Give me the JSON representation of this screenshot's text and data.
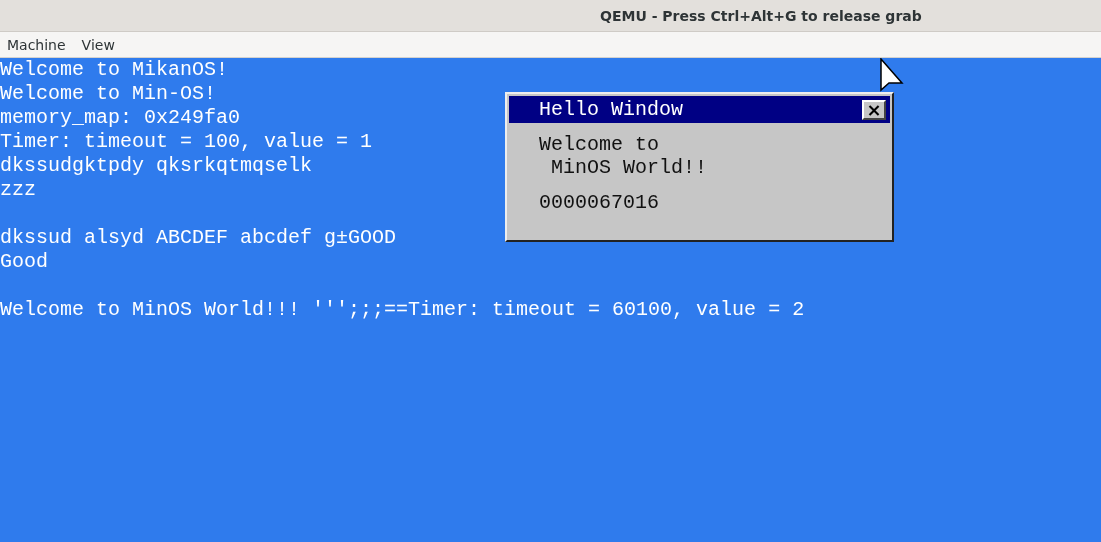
{
  "window": {
    "title": "QEMU - Press Ctrl+Alt+G to release grab"
  },
  "menu": [
    "Machine",
    "View"
  ],
  "console": {
    "paragraphs": [
      [
        "Welcome to MikanOS!",
        "Welcome to Min-OS!",
        "memory_map: 0x249fa0",
        "Timer: timeout = 100, value = 1",
        "dkssudgktpdy qksrkqtmqselk",
        "zzz"
      ],
      [
        "dkssud alsyd ABCDEF abcdef g±GOOD",
        "Good"
      ],
      [
        "Welcome to MinOS World!!! ''';;;==Timer: timeout = 60100, value = 2"
      ]
    ]
  },
  "hello_window": {
    "title": "Hello Window",
    "close": "×",
    "lines": [
      "Welcome to",
      " MinOS World!!"
    ],
    "counter": "0000067016"
  }
}
